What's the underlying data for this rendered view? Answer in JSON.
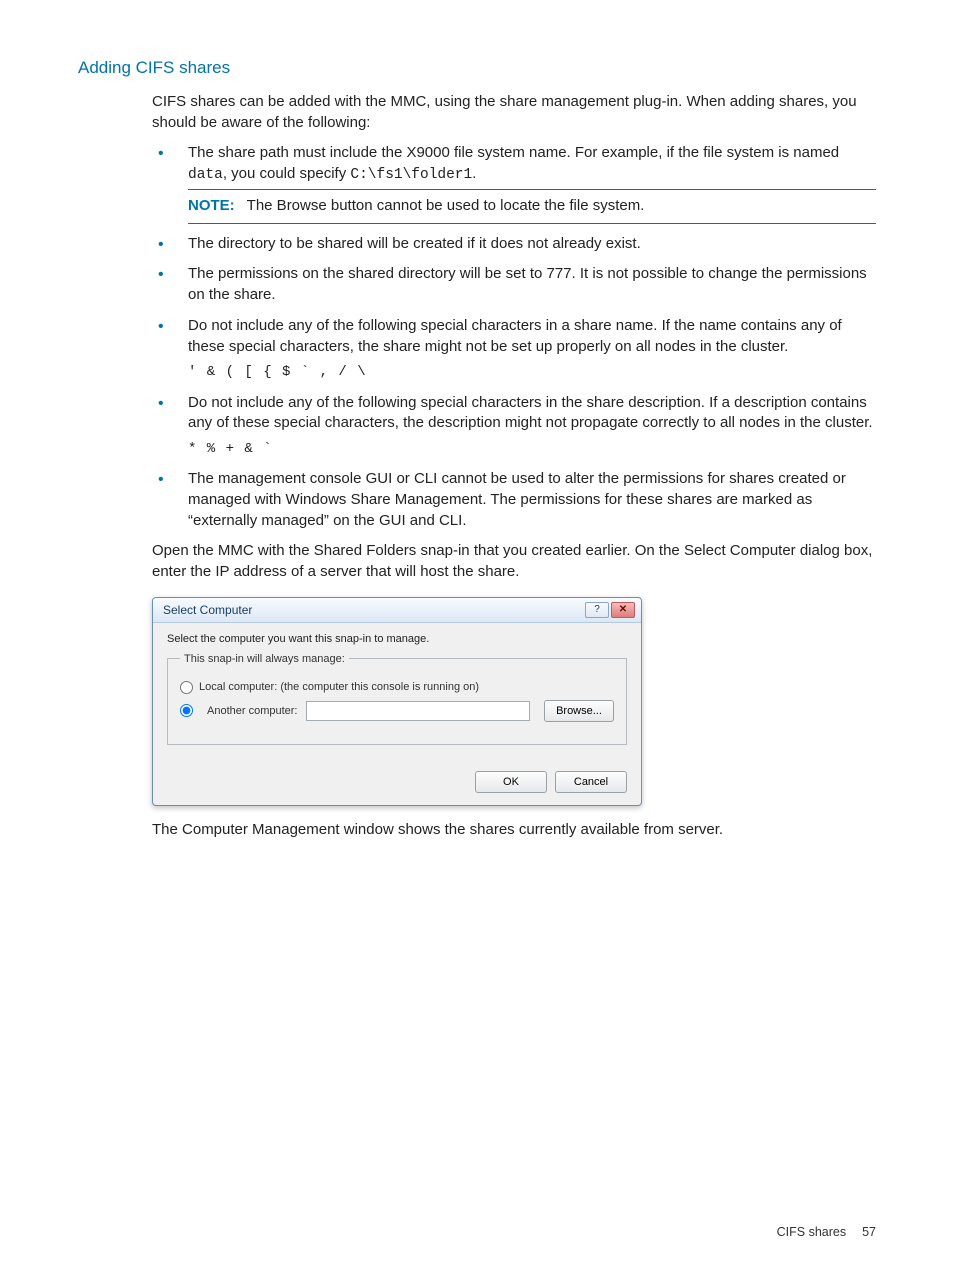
{
  "heading": "Adding CIFS shares",
  "intro": "CIFS shares can be added with the MMC, using the share management plug-in. When adding shares, you should be aware of the following:",
  "bullets": [
    {
      "pre": "The share path must include the X9000 file system name. For example, if the file system is named ",
      "mono1": "data",
      "mid": ", you could specify ",
      "mono2": "C:\\fs1\\folder1",
      "post": ".",
      "type": "path"
    },
    {
      "text": "The directory to be shared will be created if it does not already exist.",
      "type": "plain"
    },
    {
      "text": "The permissions on the shared directory will be set to 777. It is not possible to change the permissions on the share.",
      "type": "plain"
    },
    {
      "text": "Do not include any of the following special characters in a share name. If the name contains any of these special characters, the share might not be set up properly on all nodes in the cluster.",
      "code": "' & ( [ { $ ` , / \\",
      "type": "code"
    },
    {
      "text": "Do not include any of the following special characters in the share description. If a description contains any of these special characters, the description might not propagate correctly to all nodes in the cluster.",
      "code": "* % + & `",
      "type": "code"
    },
    {
      "text": "The management console GUI or CLI cannot be used to alter the permissions for shares created or managed with Windows Share Management. The permissions for these shares are marked as “externally managed” on the GUI and CLI.",
      "type": "plain"
    }
  ],
  "note": {
    "label": "NOTE:",
    "text": "The Browse button cannot be used to locate the file system."
  },
  "after_list": "Open the MMC with the Shared Folders snap-in that you created earlier. On the Select Computer dialog box, enter the IP address of a server that will host the share.",
  "after_dialog": "The Computer Management window shows the shares currently available from server.",
  "dialog": {
    "title": "Select Computer",
    "line1": "Select the computer you want this snap-in to manage.",
    "group_legend": "This snap-in will always manage:",
    "radio_local": "Local computer:  (the computer this console is running on)",
    "radio_another": "Another computer:",
    "browse": "Browse...",
    "ok": "OK",
    "cancel": "Cancel",
    "help_glyph": "?",
    "close_glyph": "✕"
  },
  "footer": {
    "section": "CIFS shares",
    "page": "57"
  }
}
